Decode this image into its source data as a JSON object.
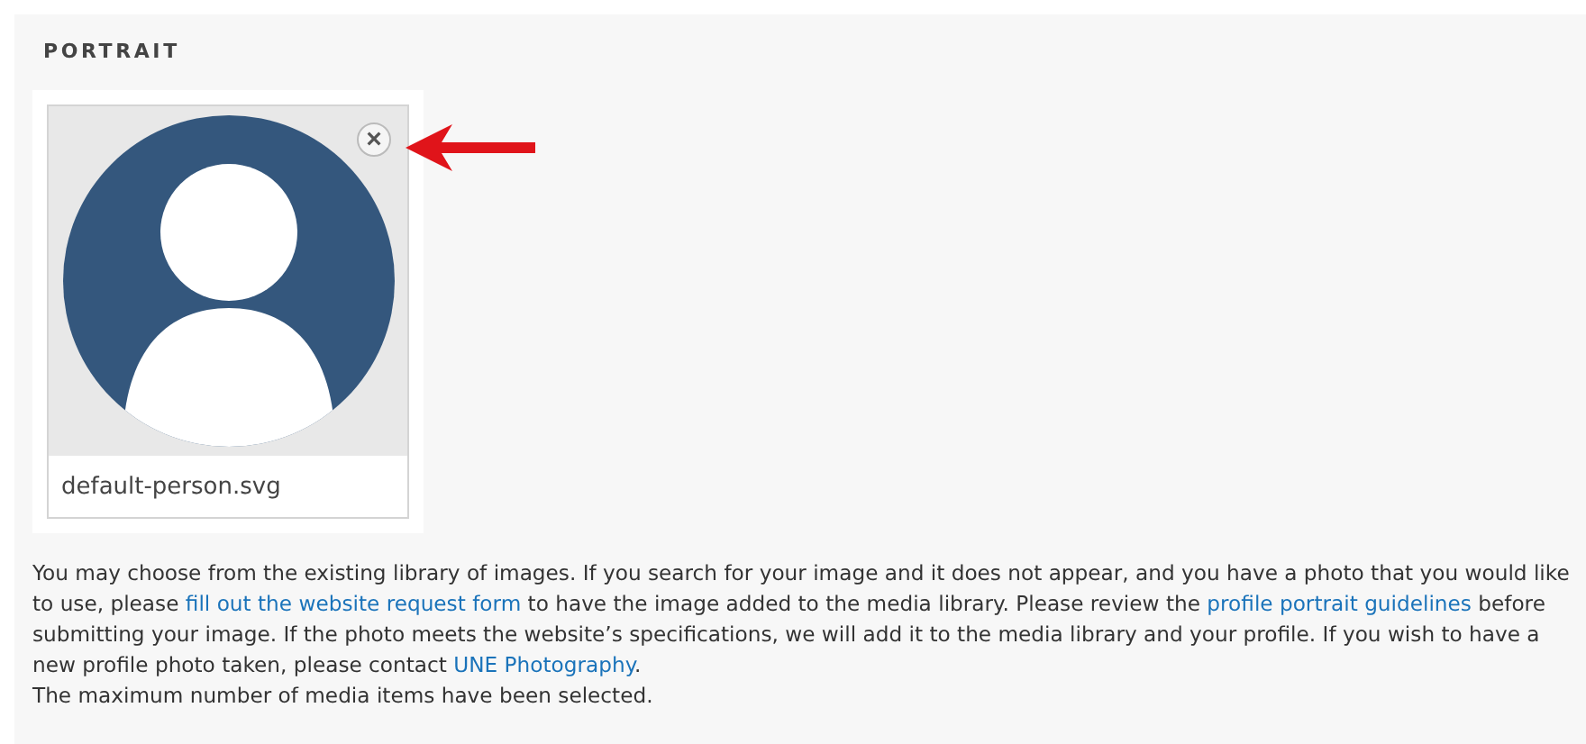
{
  "section": {
    "title": "PORTRAIT"
  },
  "media_item": {
    "filename": "default-person.svg",
    "remove_button": "×"
  },
  "description": [
    {
      "kind": "text",
      "text": "You may choose from the existing library of images. If you search for your image and it does not appear, and you have a photo that you would like to use, please "
    },
    {
      "kind": "link",
      "text": "fill out the website request form"
    },
    {
      "kind": "text",
      "text": " to have the image added to the media library. Please review the "
    },
    {
      "kind": "link",
      "text": "profile portrait guidelines"
    },
    {
      "kind": "text",
      "text": " before submitting your image. If the photo meets the website’s specifications, we will add it to the media library and your profile. If you wish to have a new profile photo taken, please contact "
    },
    {
      "kind": "link",
      "text": "UNE Photography"
    },
    {
      "kind": "text",
      "text": "."
    }
  ],
  "limit_note": "The maximum number of media items have been selected."
}
